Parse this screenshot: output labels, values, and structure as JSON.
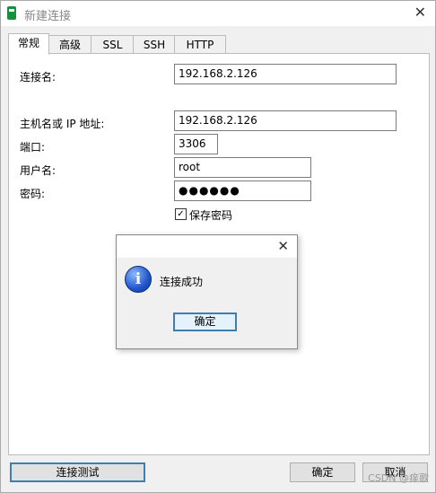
{
  "window": {
    "title": "新建连接",
    "close_glyph": "✕"
  },
  "tabs": [
    "常规",
    "高级",
    "SSL",
    "SSH",
    "HTTP"
  ],
  "form": {
    "connection_name_label": "连接名:",
    "connection_name_value": "192.168.2.126",
    "host_label": "主机名或 IP 地址:",
    "host_value": "192.168.2.126",
    "port_label": "端口:",
    "port_value": "3306",
    "user_label": "用户名:",
    "user_value": "root",
    "password_label": "密码:",
    "password_value": "●●●●●●",
    "save_password_label": "保存密码",
    "save_password_checked": true,
    "check_glyph": "✓"
  },
  "dialog": {
    "close_glyph": "✕",
    "icon_glyph": "i",
    "message": "连接成功",
    "ok_label": "确定"
  },
  "buttons": {
    "test_label": "连接测试",
    "ok_label": "确定",
    "cancel_label": "取消"
  },
  "watermark": "CSDN @痒歌",
  "icons": [
    "app-icon",
    "close-icon",
    "info-icon",
    "checkbox-check-icon"
  ]
}
